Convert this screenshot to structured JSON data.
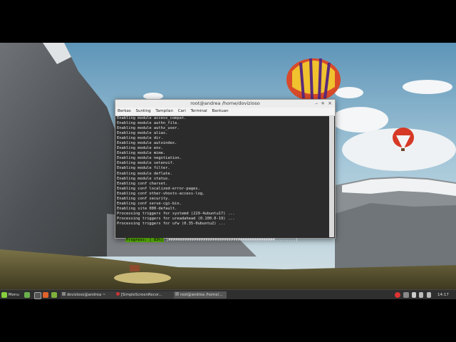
{
  "window": {
    "title": "root@andrea /home/dovizioso",
    "menu": [
      "Berkas",
      "Sunting",
      "Tampilan",
      "Cari",
      "Terminal",
      "Bantuan"
    ],
    "lines": [
      "Enabling module access_compat.",
      "Enabling module authn_file.",
      "Enabling module authz_user.",
      "Enabling module alias.",
      "Enabling module dir.",
      "Enabling module autoindex.",
      "Enabling module env.",
      "Enabling module mime.",
      "Enabling module negotiation.",
      "Enabling module setenvif.",
      "Enabling module filter.",
      "Enabling module deflate.",
      "Enabling module status.",
      "Enabling conf charset.",
      "Enabling conf localized-error-pages.",
      "Enabling conf other-vhosts-access-log.",
      "Enabling conf security.",
      "Enabling conf serve-cgi-bin.",
      "Enabling site 000-default.",
      "Processing triggers for systemd (229-4ubuntu17) ...",
      "Processing triggers for ureadahead (0.100.0-19) ...",
      "Processing triggers for ufw (0.35-0ubuntu2) ..."
    ],
    "progress_label": "Progress: [ 83%]",
    "progress_bar": "[##############################################.........]",
    "progress_value": 0.83
  },
  "panel": {
    "menu_label": "Menu",
    "tasks": [
      "dovizioso@andrea ~",
      "[SimpleScreenRecor...",
      "root@andrea /home/..."
    ],
    "clock": "14:17"
  },
  "colors": {
    "panel_bg": "#2f2f2f",
    "terminal_bg": "#2b2b2b",
    "progress_green": "#4e9a06",
    "mint_green": "#87cf3e"
  }
}
